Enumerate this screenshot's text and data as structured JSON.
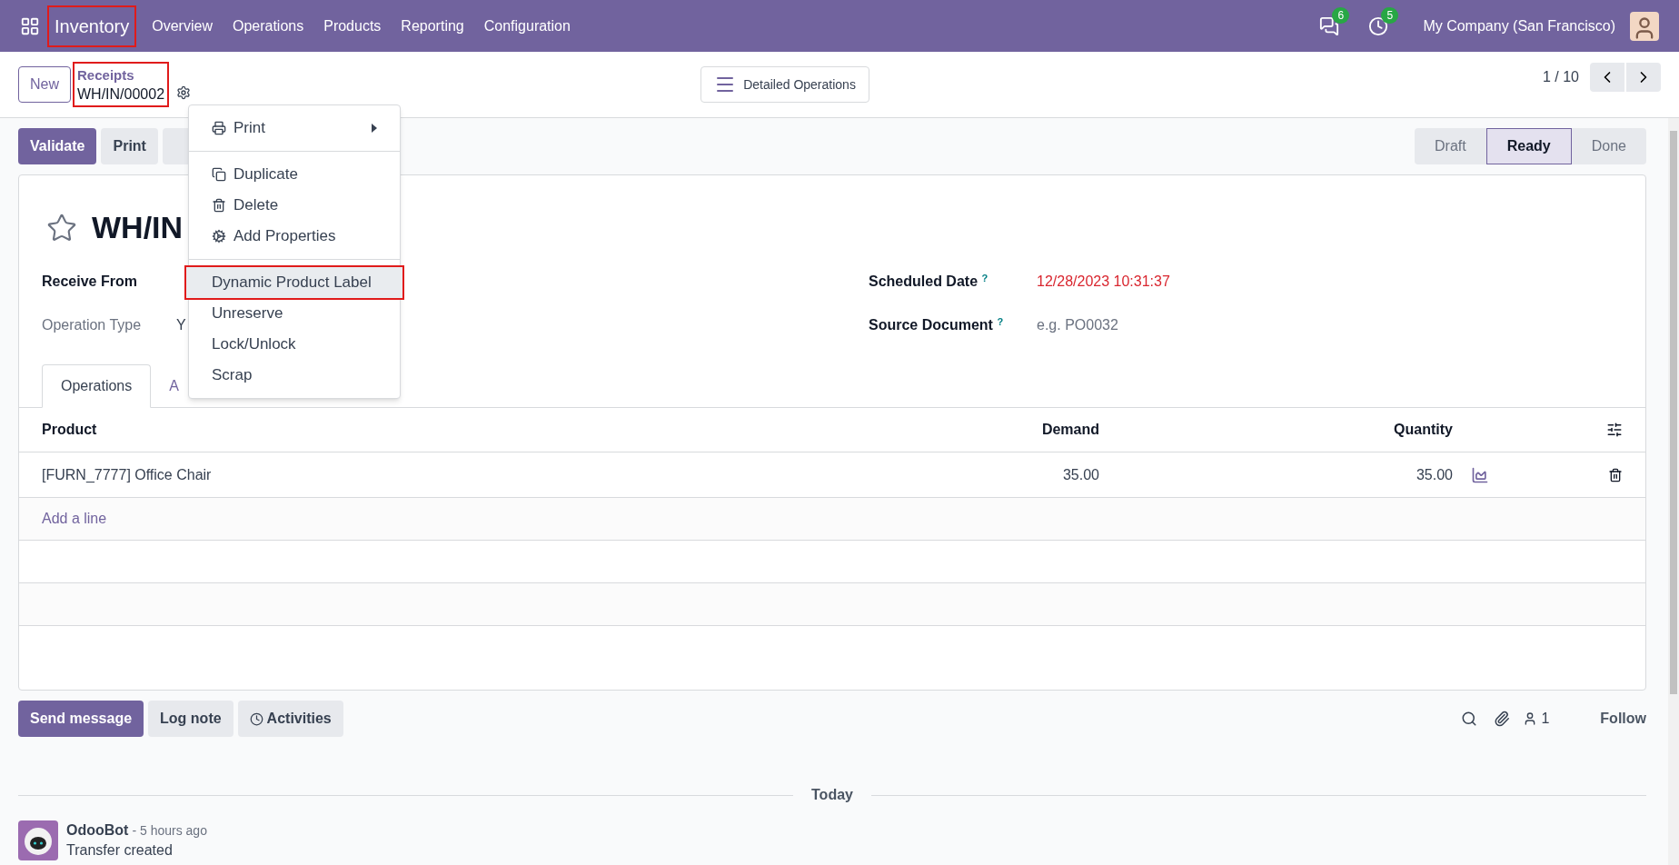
{
  "navbar": {
    "app": {
      "label": "Inventory",
      "highlighted": true
    },
    "menu": [
      "Overview",
      "Operations",
      "Products",
      "Reporting",
      "Configuration"
    ],
    "messages_badge": "6",
    "activities_badge": "5",
    "company": "My Company (San Francisco)"
  },
  "control_panel": {
    "new_button": "New",
    "breadcrumb": {
      "parent": "Receipts",
      "current": "WH/IN/00002",
      "highlighted": true
    },
    "detailed_button": "Detailed Operations",
    "pager": "1 / 10"
  },
  "actions": [
    {
      "label": "Validate",
      "kind": "primary"
    },
    {
      "label": "Print",
      "kind": "secondary"
    },
    {
      "kind": "covered"
    }
  ],
  "statusbar": [
    {
      "label": "Draft",
      "selected": false
    },
    {
      "label": "Ready",
      "selected": true
    },
    {
      "label": "Done",
      "selected": false
    }
  ],
  "gear_menu": [
    {
      "kind": "submenu",
      "label": "Print",
      "highlighted": false
    },
    {
      "kind": "divider"
    },
    {
      "kind": "item",
      "label": "Duplicate",
      "highlighted": false
    },
    {
      "kind": "item",
      "label": "Delete",
      "highlighted": false
    },
    {
      "kind": "item",
      "label": "Add Properties",
      "highlighted": false
    },
    {
      "kind": "divider"
    },
    {
      "kind": "item",
      "label": "Dynamic Product Label",
      "highlighted": true
    },
    {
      "kind": "item",
      "label": "Unreserve",
      "highlighted": false
    },
    {
      "kind": "item",
      "label": "Lock/Unlock",
      "highlighted": false
    },
    {
      "kind": "item",
      "label": "Scrap",
      "highlighted": false
    }
  ],
  "form": {
    "title": "WH/IN",
    "starred": false,
    "left_fields": [
      {
        "label": "Receive From"
      },
      {
        "label": "Operation Type",
        "value": "Y"
      }
    ],
    "right_fields": [
      {
        "label": "Scheduled Date",
        "help": "?",
        "value": "12/28/2023 10:31:37",
        "kind": "overdue"
      },
      {
        "label": "Source Document",
        "help": "?",
        "placeholder": "e.g. PO0032",
        "kind": "placeholder"
      }
    ],
    "tabs": [
      {
        "label": "Operations",
        "selected": true
      },
      {
        "label": "A",
        "selected": false
      }
    ],
    "table": {
      "columns": [
        "Product",
        "Demand",
        "Quantity"
      ],
      "rows": [
        {
          "product": "[FURN_7777] Office Chair",
          "demand": "35.00",
          "quantity": "35.00"
        }
      ],
      "add_line": "Add a line"
    }
  },
  "chatter": {
    "buttons": [
      {
        "label": "Send message",
        "kind": "primary"
      },
      {
        "label": "Log note",
        "kind": "secondary"
      },
      {
        "label": "Activities",
        "kind": "activities"
      }
    ],
    "followers": "1",
    "follow": "Follow",
    "divider": "Today",
    "messages": [
      {
        "author": "OdooBot",
        "time": "- 5 hours ago",
        "body": "Transfer created"
      }
    ]
  }
}
